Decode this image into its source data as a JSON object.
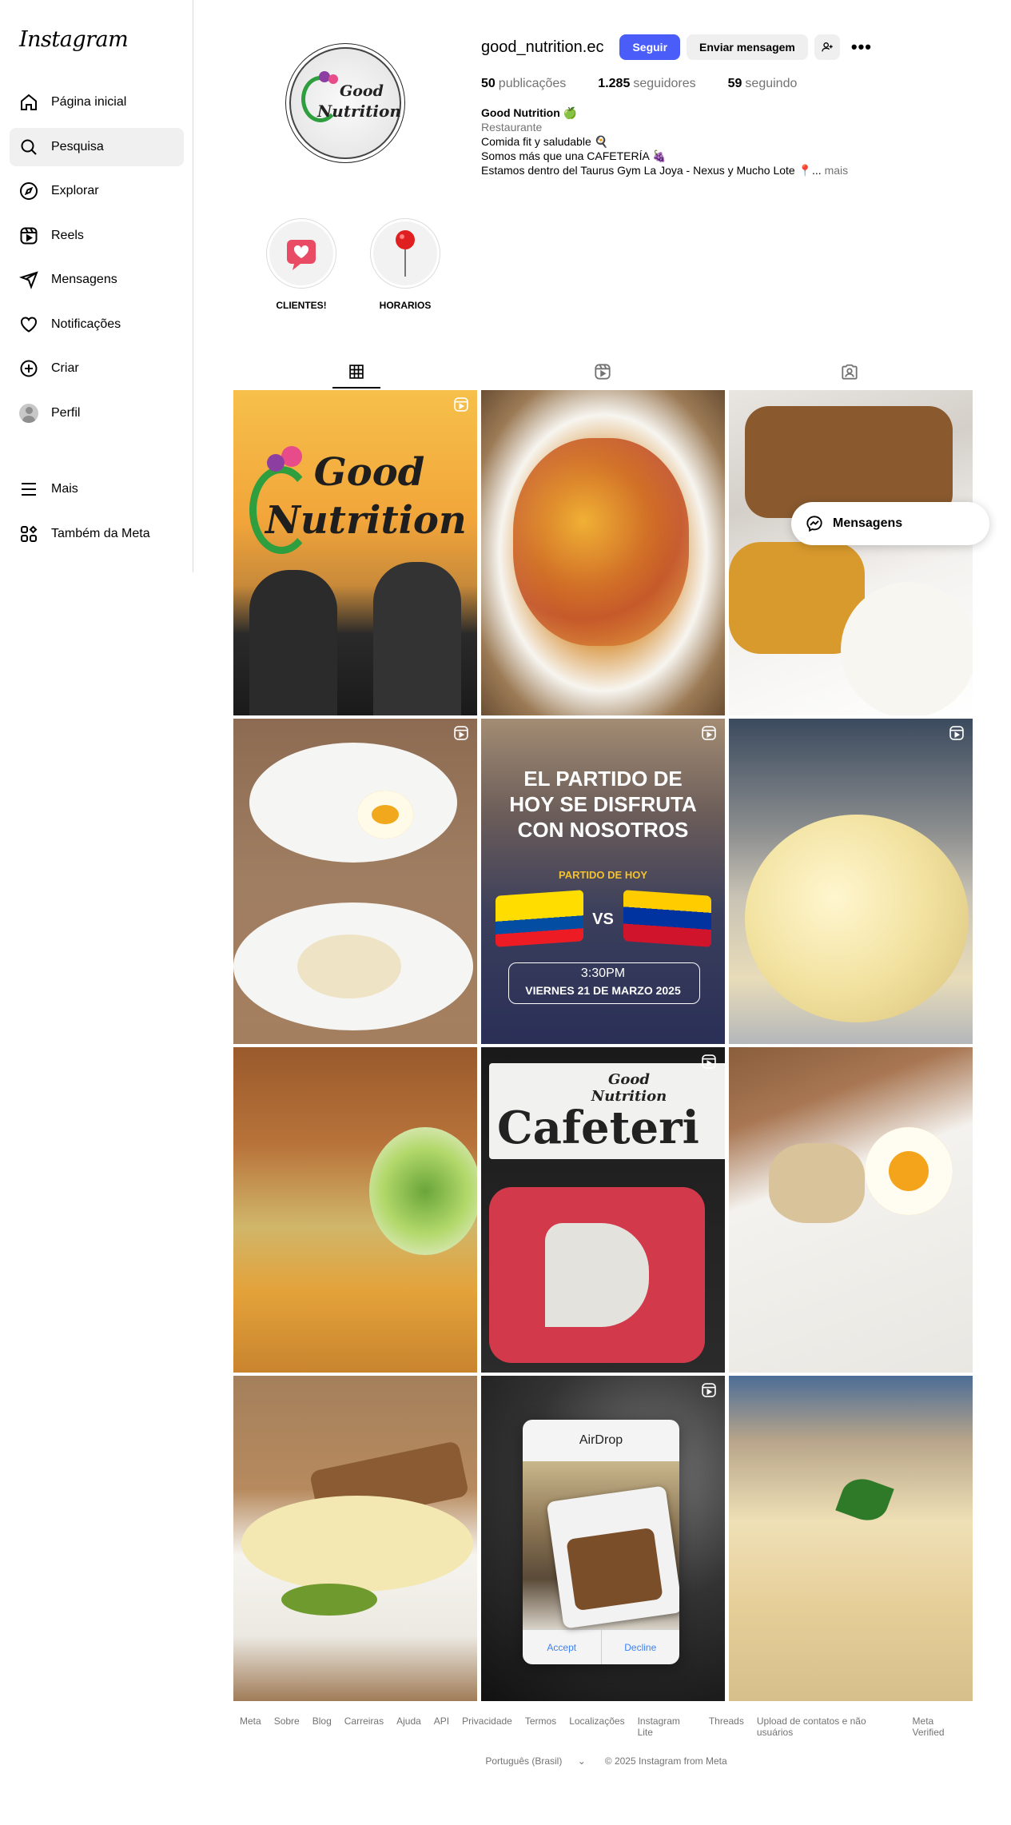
{
  "app": {
    "logo": "Instagram"
  },
  "sidebar": {
    "items": [
      {
        "label": "Página inicial",
        "icon": "home-icon"
      },
      {
        "label": "Pesquisa",
        "icon": "search-icon"
      },
      {
        "label": "Explorar",
        "icon": "compass-icon"
      },
      {
        "label": "Reels",
        "icon": "reels-icon"
      },
      {
        "label": "Mensagens",
        "icon": "send-icon"
      },
      {
        "label": "Notificações",
        "icon": "heart-icon"
      },
      {
        "label": "Criar",
        "icon": "plus-square-icon"
      },
      {
        "label": "Perfil",
        "icon": "avatar"
      }
    ],
    "bottom": [
      {
        "label": "Mais",
        "icon": "menu-icon"
      },
      {
        "label": "Também da Meta",
        "icon": "meta-apps-icon"
      }
    ]
  },
  "profile": {
    "username": "good_nutrition.ec",
    "follow_label": "Seguir",
    "message_label": "Enviar mensagem",
    "logo_line1": "Good",
    "logo_line2": "Nutrition",
    "stats": {
      "posts_count": "50",
      "posts_label": "publicações",
      "followers_count": "1.285",
      "followers_label": "seguidores",
      "following_count": "59",
      "following_label": "seguindo"
    },
    "bio": {
      "name": "Good Nutrition 🍏",
      "category": "Restaurante",
      "line1": "Comida fit y saludable 🍳",
      "line2": "Somos más que una CAFETERÍA 🍇",
      "line3": "Estamos dentro del Taurus Gym La Joya - Nexus y Mucho Lote 📍...",
      "more": "mais"
    }
  },
  "highlights": [
    {
      "label": "CLIENTES!"
    },
    {
      "label": "HORARIOS"
    }
  ],
  "posts": {
    "p1_line1": "Good",
    "p1_line2": "Nutrition",
    "p5_line1": "EL PARTIDO DE",
    "p5_line2": "HOY SE DISFRUTA",
    "p5_line3": "CON NOSOTROS",
    "p5_sub": "PARTIDO DE HOY",
    "p5_vs": "VS",
    "p5_time": "3:30PM",
    "p5_date": "VIERNES 21 DE MARZO 2025",
    "p8_brand": "Good Nutrition",
    "p8_sign": "Cafeteri"
  },
  "messages_pill": {
    "label": "Mensagens"
  },
  "airdrop": {
    "title": "AirDrop",
    "accept": "Accept",
    "decline": "Decline"
  },
  "footer": {
    "links": [
      "Meta",
      "Sobre",
      "Blog",
      "Carreiras",
      "Ajuda",
      "API",
      "Privacidade",
      "Termos",
      "Localizações",
      "Instagram Lite",
      "Threads",
      "Upload de contatos e não usuários",
      "Meta Verified"
    ],
    "language": "Português (Brasil)",
    "copyright": "© 2025 Instagram from Meta"
  },
  "colors": {
    "primary_button": "#4a5df9",
    "secondary_button": "#efefef",
    "muted_text": "#737373"
  }
}
